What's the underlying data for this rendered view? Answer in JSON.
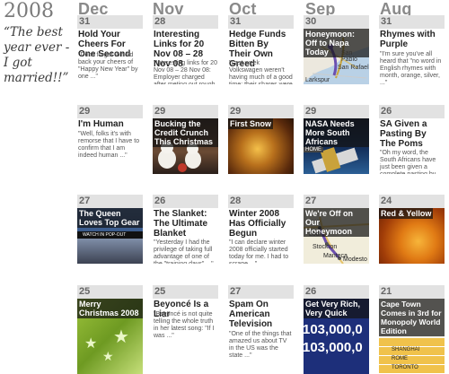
{
  "year": "2008",
  "quote": "“The best year ever - I got married!!”",
  "months": [
    "Dec",
    "Nov",
    "Oct",
    "Sep",
    "Aug"
  ],
  "rows": [
    [
      {
        "day": "31",
        "title": "Hold Your Cheers For One Second",
        "excerpt": "\"Don't forget to hold back your cheers of \"Happy New Year\" by one ...\""
      },
      {
        "day": "28",
        "title": "Interesting Links for 20 Nov 08 – 28 Nov 08",
        "excerpt": "\"Interesting links for 20 Nov 08 – 28 Nov 08: Employer charged after meting out rough ...\""
      },
      {
        "day": "31",
        "title": "Hedge Funds Bitten By Their Own Greed",
        "excerpt": "\"Last week Volkswagen weren't having much of a good time: their shares were down more ...\""
      },
      {
        "day": "30",
        "caption": "Honeymoon: Off to Napa Today",
        "map": [
          "San Pablo",
          "San Rafael",
          "Larkspur"
        ]
      },
      {
        "day": "31",
        "title": "Rhymes with Purple",
        "excerpt": "\"I'm sure you've all heard that \"no word in English rhymes with month, orange, silver, ...\""
      }
    ],
    [
      {
        "day": "29",
        "title": "I'm Human",
        "excerpt": "\"Well, folks it's with remorse that I have to confirm that I am indeed human ...\""
      },
      {
        "day": "29",
        "caption": "Bucking the Credit Crunch This Christmas"
      },
      {
        "day": "29",
        "caption": "First Snow"
      },
      {
        "day": "29",
        "caption": "NASA Needs More South Africans",
        "badge": "HOME"
      },
      {
        "day": "26",
        "title": "SA Given a Pasting By The Poms",
        "excerpt": "\"Oh my word, the South Africans have just been given a complete pasting by England ...\""
      }
    ],
    [
      {
        "day": "27",
        "caption": "The Queen Loves Top Gear",
        "sub": "WATCH IN POP-OUT PLAYER"
      },
      {
        "day": "26",
        "title": "The Slanket: The Ultimate Blanket",
        "excerpt": "\"Yesterday I had the privilege of taking full advantage of one of the \"training days\" ...\""
      },
      {
        "day": "28",
        "title": "Winter 2008 Has Officially Begun",
        "excerpt": "\"I can declare winter 2008 officially started today for me. I had to scrape ...\""
      },
      {
        "day": "27",
        "caption": "We're Off on Our Honeymoon",
        "map": [
          "Lodi",
          "Stockton",
          "Manteca",
          "Modesto"
        ]
      },
      {
        "day": "24",
        "caption": "Red & Yellow"
      }
    ],
    [
      {
        "day": "25",
        "caption": "Merry Christmas 2008"
      },
      {
        "day": "25",
        "title": "Beyoncé Is a Liar",
        "excerpt": "\"Beyoncé is not quite telling the whole truth in her latest song: \"If I was ...\""
      },
      {
        "day": "27",
        "title": "Spam On American Television",
        "excerpt": "\"One of the things that amazed us about TV in the US was the state ...\""
      },
      {
        "day": "26",
        "caption": "Get Very Rich, Very Quick",
        "big": [
          "103,000,0",
          "103,000,0"
        ]
      },
      {
        "day": "21",
        "caption": "Cape Town Comes in 3rd for Monopoly World Edition",
        "list": [
          "SHANGHAI",
          "ROME",
          "TORONTO"
        ]
      }
    ]
  ]
}
